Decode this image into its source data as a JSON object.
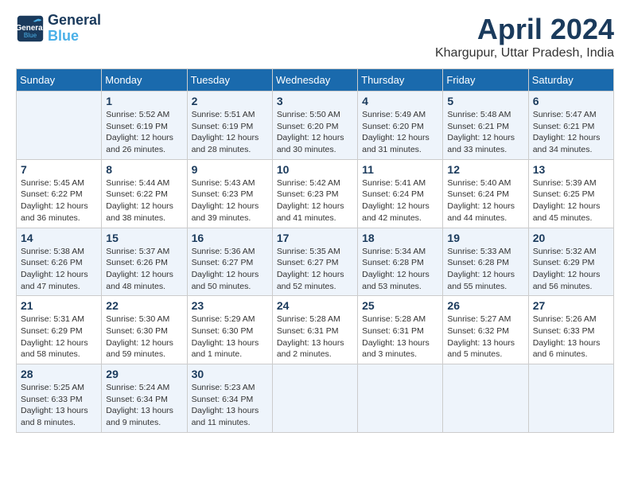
{
  "logo": {
    "line1": "General",
    "line2": "Blue"
  },
  "title": "April 2024",
  "subtitle": "Khargupur, Uttar Pradesh, India",
  "days_of_week": [
    "Sunday",
    "Monday",
    "Tuesday",
    "Wednesday",
    "Thursday",
    "Friday",
    "Saturday"
  ],
  "weeks": [
    [
      {
        "day": "",
        "info": ""
      },
      {
        "day": "1",
        "info": "Sunrise: 5:52 AM\nSunset: 6:19 PM\nDaylight: 12 hours\nand 26 minutes."
      },
      {
        "day": "2",
        "info": "Sunrise: 5:51 AM\nSunset: 6:19 PM\nDaylight: 12 hours\nand 28 minutes."
      },
      {
        "day": "3",
        "info": "Sunrise: 5:50 AM\nSunset: 6:20 PM\nDaylight: 12 hours\nand 30 minutes."
      },
      {
        "day": "4",
        "info": "Sunrise: 5:49 AM\nSunset: 6:20 PM\nDaylight: 12 hours\nand 31 minutes."
      },
      {
        "day": "5",
        "info": "Sunrise: 5:48 AM\nSunset: 6:21 PM\nDaylight: 12 hours\nand 33 minutes."
      },
      {
        "day": "6",
        "info": "Sunrise: 5:47 AM\nSunset: 6:21 PM\nDaylight: 12 hours\nand 34 minutes."
      }
    ],
    [
      {
        "day": "7",
        "info": "Sunrise: 5:45 AM\nSunset: 6:22 PM\nDaylight: 12 hours\nand 36 minutes."
      },
      {
        "day": "8",
        "info": "Sunrise: 5:44 AM\nSunset: 6:22 PM\nDaylight: 12 hours\nand 38 minutes."
      },
      {
        "day": "9",
        "info": "Sunrise: 5:43 AM\nSunset: 6:23 PM\nDaylight: 12 hours\nand 39 minutes."
      },
      {
        "day": "10",
        "info": "Sunrise: 5:42 AM\nSunset: 6:23 PM\nDaylight: 12 hours\nand 41 minutes."
      },
      {
        "day": "11",
        "info": "Sunrise: 5:41 AM\nSunset: 6:24 PM\nDaylight: 12 hours\nand 42 minutes."
      },
      {
        "day": "12",
        "info": "Sunrise: 5:40 AM\nSunset: 6:24 PM\nDaylight: 12 hours\nand 44 minutes."
      },
      {
        "day": "13",
        "info": "Sunrise: 5:39 AM\nSunset: 6:25 PM\nDaylight: 12 hours\nand 45 minutes."
      }
    ],
    [
      {
        "day": "14",
        "info": "Sunrise: 5:38 AM\nSunset: 6:26 PM\nDaylight: 12 hours\nand 47 minutes."
      },
      {
        "day": "15",
        "info": "Sunrise: 5:37 AM\nSunset: 6:26 PM\nDaylight: 12 hours\nand 48 minutes."
      },
      {
        "day": "16",
        "info": "Sunrise: 5:36 AM\nSunset: 6:27 PM\nDaylight: 12 hours\nand 50 minutes."
      },
      {
        "day": "17",
        "info": "Sunrise: 5:35 AM\nSunset: 6:27 PM\nDaylight: 12 hours\nand 52 minutes."
      },
      {
        "day": "18",
        "info": "Sunrise: 5:34 AM\nSunset: 6:28 PM\nDaylight: 12 hours\nand 53 minutes."
      },
      {
        "day": "19",
        "info": "Sunrise: 5:33 AM\nSunset: 6:28 PM\nDaylight: 12 hours\nand 55 minutes."
      },
      {
        "day": "20",
        "info": "Sunrise: 5:32 AM\nSunset: 6:29 PM\nDaylight: 12 hours\nand 56 minutes."
      }
    ],
    [
      {
        "day": "21",
        "info": "Sunrise: 5:31 AM\nSunset: 6:29 PM\nDaylight: 12 hours\nand 58 minutes."
      },
      {
        "day": "22",
        "info": "Sunrise: 5:30 AM\nSunset: 6:30 PM\nDaylight: 12 hours\nand 59 minutes."
      },
      {
        "day": "23",
        "info": "Sunrise: 5:29 AM\nSunset: 6:30 PM\nDaylight: 13 hours\nand 1 minute."
      },
      {
        "day": "24",
        "info": "Sunrise: 5:28 AM\nSunset: 6:31 PM\nDaylight: 13 hours\nand 2 minutes."
      },
      {
        "day": "25",
        "info": "Sunrise: 5:28 AM\nSunset: 6:31 PM\nDaylight: 13 hours\nand 3 minutes."
      },
      {
        "day": "26",
        "info": "Sunrise: 5:27 AM\nSunset: 6:32 PM\nDaylight: 13 hours\nand 5 minutes."
      },
      {
        "day": "27",
        "info": "Sunrise: 5:26 AM\nSunset: 6:33 PM\nDaylight: 13 hours\nand 6 minutes."
      }
    ],
    [
      {
        "day": "28",
        "info": "Sunrise: 5:25 AM\nSunset: 6:33 PM\nDaylight: 13 hours\nand 8 minutes."
      },
      {
        "day": "29",
        "info": "Sunrise: 5:24 AM\nSunset: 6:34 PM\nDaylight: 13 hours\nand 9 minutes."
      },
      {
        "day": "30",
        "info": "Sunrise: 5:23 AM\nSunset: 6:34 PM\nDaylight: 13 hours\nand 11 minutes."
      },
      {
        "day": "",
        "info": ""
      },
      {
        "day": "",
        "info": ""
      },
      {
        "day": "",
        "info": ""
      },
      {
        "day": "",
        "info": ""
      }
    ]
  ],
  "colors": {
    "header_bg": "#1a6aad",
    "title_color": "#1a3a5c",
    "accent": "#1a6aad"
  }
}
